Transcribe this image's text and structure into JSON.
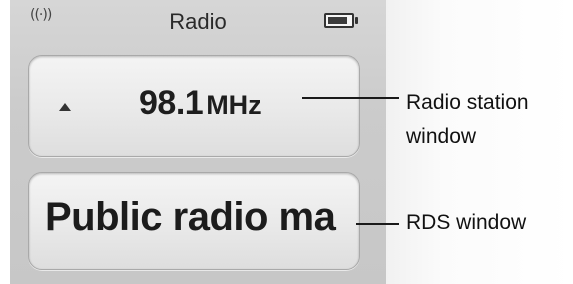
{
  "status_bar": {
    "wave_icon": "radio-wave-icon",
    "wave_glyph": "((·))",
    "title": "Radio",
    "battery_icon": "battery-icon"
  },
  "station_window": {
    "arrow_icon": "up-arrow-icon",
    "frequency": "98.1",
    "unit": "MHz"
  },
  "rds_window": {
    "text": "Public radio ma"
  },
  "callouts": {
    "station_line1": "Radio station",
    "station_line2": "window",
    "rds": "RDS window"
  }
}
